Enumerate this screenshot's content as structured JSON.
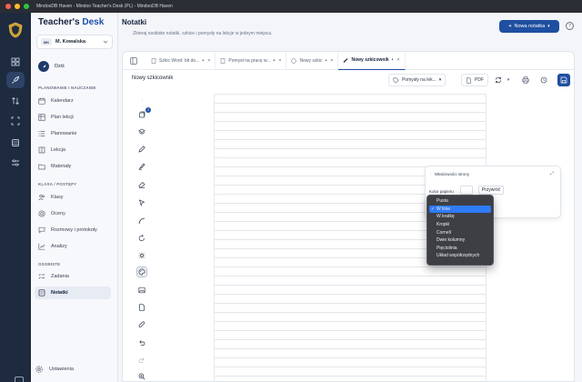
{
  "window": {
    "title": "MindooDB Haven - Mindoo Teacher's Desk (PL) - MindooDB Haven"
  },
  "brand": {
    "part1": "Teacher's",
    "part2": "Desk"
  },
  "user": {
    "initials": "MK",
    "name": "M. Kowalska"
  },
  "today_label": "Dziś",
  "sidebar": {
    "section_planning": "PLANOWANIE I NAUCZANIE",
    "planning_items": [
      "Kalendarz",
      "Plan lekcji",
      "Planowanie",
      "Lekcja",
      "Materiały"
    ],
    "section_class": "KLASA / POSTĘPY",
    "class_items": [
      "Klasy",
      "Oceny",
      "Rozmowy i protokoły",
      "Analizy"
    ],
    "section_personal": "OSOBISTE",
    "personal_items": [
      "Zadania",
      "Notatki"
    ],
    "settings": "Ustawienia"
  },
  "header": {
    "title": "Notatki",
    "subtitle": "Zbieraj osobiste notatki, szkice i pomysły na lekcje w jednym miejscu.",
    "new_note": "Nowa notatka",
    "help": "?"
  },
  "tabs": [
    {
      "label": "Szkic Word: bit do...",
      "modified": "•",
      "close": "×"
    },
    {
      "label": "Pomysł na pracę w...",
      "modified": "•",
      "close": "×"
    },
    {
      "label": "Nowy szkic",
      "modified": "•",
      "close": "×"
    },
    {
      "label": "Nowy szkicownik",
      "modified": "•",
      "close": "×",
      "active": true
    }
  ],
  "toolbar": {
    "note_title": "Nowy szkicownik",
    "category": "Pomysły na lek...",
    "pdf": "PDF"
  },
  "tools_badge": "2",
  "properties": {
    "title": "Właściwości strony",
    "paper_label": "Kolor papieru",
    "restore": "Przywróć"
  },
  "paper_options": {
    "selected_index": 1,
    "items": [
      "Pusta",
      "W linie",
      "W kratkę",
      "Kropki",
      "Cornell",
      "Dwie kolumny",
      "Pięciolinia",
      "Układ współrzędnych"
    ],
    "check": "✓"
  },
  "colors": {
    "accent": "#1e4fa0",
    "rail": "#1e2a3e",
    "selected": "#2f7bf6"
  }
}
